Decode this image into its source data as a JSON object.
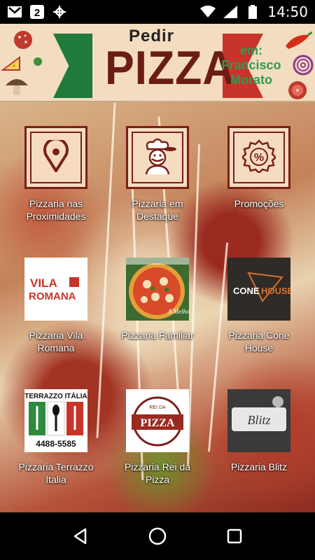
{
  "status_bar": {
    "time": "14:50",
    "icons": [
      "gmail-icon",
      "two-notification-icon",
      "sync-icon",
      "wifi-icon",
      "signal-icon",
      "battery-icon"
    ]
  },
  "header": {
    "pedir": "Pedir",
    "title": "PIZZA",
    "location": "em: Francisco Morato",
    "colors": {
      "green": "#1f7a3c",
      "red": "#c8342a",
      "title": "#6b1c16",
      "location": "#2e9b4e"
    }
  },
  "menu": [
    {
      "label": "Pizzaria nas Proximidades",
      "icon": "location-pin-icon"
    },
    {
      "label": "Pizzaria em Destaque",
      "icon": "chef-icon"
    },
    {
      "label": "Promoções",
      "icon": "percent-badge-icon"
    }
  ],
  "pizzerias": [
    {
      "label": "Pizzaria Vila Romana",
      "logo_text": "VILA ROMANA"
    },
    {
      "label": "Pizzaria Familiar",
      "logo_text": "A Melhor"
    },
    {
      "label": "Pizzaria Cone House",
      "logo_text": "CONE HOUSE"
    },
    {
      "label": "Pizzaria Terrazzo Italia",
      "logo_text": "TERRAZZO ITÁLIA",
      "phone": "4488-5585"
    },
    {
      "label": "Pizzaria Rei da Pizza",
      "logo_text": "PIZZA"
    },
    {
      "label": "Pizzaria Blitz",
      "logo_text": "Blitz"
    }
  ],
  "nav": [
    "back-icon",
    "home-icon",
    "recents-icon"
  ]
}
